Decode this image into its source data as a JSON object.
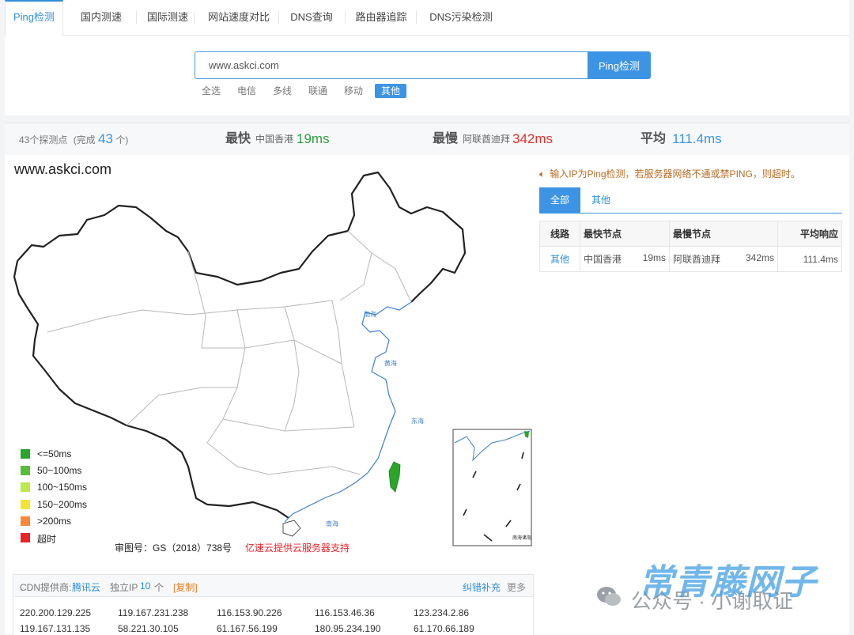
{
  "tabs": [
    "Ping检测",
    "国内测速",
    "国际测速",
    "网站速度对比",
    "DNS查询",
    "路由器追踪",
    "DNS污染检测"
  ],
  "search": {
    "value": "www.askci.com",
    "button": "Ping检测"
  },
  "filters": [
    "全选",
    "电信",
    "多线",
    "联通",
    "移动",
    "其他"
  ],
  "stats": {
    "points_text": "43个探测点",
    "complete_prefix": "(完成",
    "complete_count": "43",
    "complete_suffix": "个)",
    "fastest_label": "最快",
    "fastest_node": "中国香港",
    "fastest_value": "19ms",
    "slowest_label": "最慢",
    "slowest_node": "阿联酋迪拜",
    "slowest_value": "342ms",
    "average_label": "平均",
    "average_value": "111.4ms"
  },
  "map": {
    "domain": "www.askci.com",
    "legend": [
      {
        "label": "<=50ms",
        "color": "#2aa52a"
      },
      {
        "label": "50~100ms",
        "color": "#58bd3a"
      },
      {
        "label": "100~150ms",
        "color": "#bde94a"
      },
      {
        "label": "150~200ms",
        "color": "#f5e435"
      },
      {
        "label": ">200ms",
        "color": "#f7893c"
      },
      {
        "label": "超时",
        "color": "#e8232a"
      }
    ],
    "approval": "审图号：GS（2018）738号",
    "provider_note": "亿速云提供云服务器支持",
    "sea_labels": [
      "渤海",
      "黄海",
      "东海",
      "南海"
    ],
    "inset_label": "南海诸岛"
  },
  "notice": "输入IP为Ping检测，若服务器网络不通或禁PING，则超时。",
  "result_tabs": [
    "全部",
    "其他"
  ],
  "table": {
    "headers": [
      "线路",
      "最快节点",
      "最慢节点",
      "平均响应"
    ],
    "row": {
      "line": "其他",
      "fast_node": "中国香港",
      "fast_ms": "19ms",
      "slow_node": "阿联酋迪拜",
      "slow_ms": "342ms",
      "avg": "111.4ms"
    }
  },
  "cdn": {
    "provider_label": "CDN提供商:",
    "provider": "腾讯云",
    "ip_label": "独立IP",
    "ip_count": "10",
    "ip_unit": "个",
    "copy": "[复制]",
    "correct": "纠错补充",
    "more": "更多",
    "ips": [
      "220.200.129.225",
      "119.167.231.238",
      "116.153.90.226",
      "116.153.46.36",
      "123.234.2.86",
      "119.167.131.135",
      "58.221.30.105",
      "61.167.56.199",
      "180.95.234.190",
      "61.170.66.189"
    ]
  },
  "watermark": {
    "text1": "公众号 · 小谢取证",
    "text2": "常青藤网子"
  },
  "colors": {
    "accent": "#3d94e4",
    "fast": "#2e9e3e",
    "slow": "#e8302a",
    "avg": "#3d94e4"
  }
}
